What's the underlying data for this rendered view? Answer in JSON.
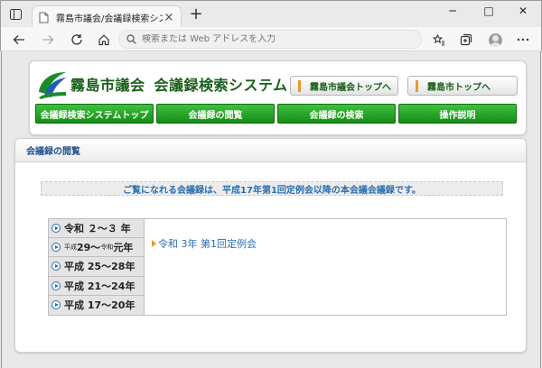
{
  "browser": {
    "tab_title": "霧島市議会/会議録検索システム",
    "address_placeholder": "検索または Web アドレスを入力",
    "close_glyph": "×",
    "newtab_glyph": "+",
    "window_controls": {
      "minimize": "─",
      "maximize": "□",
      "close": "✕"
    }
  },
  "header": {
    "site_name": "霧島市議会",
    "system_name": "会議録検索システム",
    "top_links": [
      "霧島市議会トップへ",
      "霧島市トップへ"
    ],
    "nav": [
      "会議録検索システムトップ",
      "会議録の閲覧",
      "会議録の検索",
      "操作説明"
    ]
  },
  "main": {
    "section_title": "会議録の閲覧",
    "notice": "ご覧になれる会議録は、平成17年第1回定例会以降の本会議会議録です。",
    "years": [
      {
        "label": "令和 ２～３ 年"
      },
      {
        "pre": "平成",
        "mid": "29～",
        "small2": "令和",
        "post": "元年"
      },
      {
        "label": "平成 25～28年"
      },
      {
        "label": "平成 21～24年"
      },
      {
        "label": "平成 17～20年"
      }
    ],
    "session_link": "令和 3年 第1回定例会"
  },
  "colors": {
    "green_dark": "#148c14",
    "green_title": "#1a5f1a",
    "blue_link": "#2a6fb0",
    "orange_accent": "#e89a2a"
  }
}
